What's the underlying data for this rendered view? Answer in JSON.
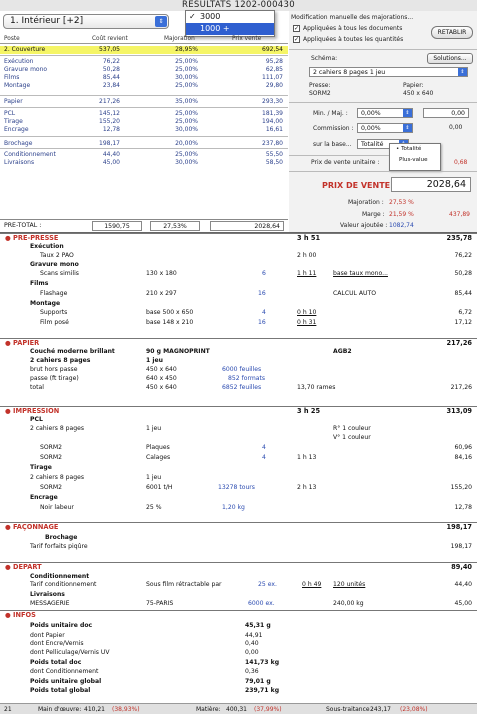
{
  "window": {
    "title": "RESULTATS 1202-000430"
  },
  "selector": {
    "value": "1. Intérieur [+2]"
  },
  "menu": {
    "items": [
      "3000",
      "1000 +"
    ],
    "checked_mark": "✓"
  },
  "left": {
    "headers": {
      "poste": "Poste",
      "cout": "Coût revient",
      "majoration": "Majoration",
      "prix": "Prix vente"
    },
    "rows": [
      {
        "name": "2. Couverture",
        "cout": "537,05",
        "maj": "28,95%",
        "prix": "692,54"
      },
      {
        "name": "Exécution",
        "cout": "76,22",
        "maj": "25,00%",
        "prix": "95,28"
      },
      {
        "name": "Gravure mono",
        "cout": "50,28",
        "maj": "25,00%",
        "prix": "62,85"
      },
      {
        "name": "Films",
        "cout": "85,44",
        "maj": "30,00%",
        "prix": "111,07"
      },
      {
        "name": "Montage",
        "cout": "23,84",
        "maj": "25,00%",
        "prix": "29,80"
      },
      {
        "name": "Papier",
        "cout": "217,26",
        "maj": "35,00%",
        "prix": "293,30"
      },
      {
        "name": "PCL",
        "cout": "145,12",
        "maj": "25,00%",
        "prix": "181,39"
      },
      {
        "name": "Tirage",
        "cout": "155,20",
        "maj": "25,00%",
        "prix": "194,00"
      },
      {
        "name": "Encrage",
        "cout": "12,78",
        "maj": "30,00%",
        "prix": "16,61"
      },
      {
        "name": "Brochage",
        "cout": "198,17",
        "maj": "20,00%",
        "prix": "237,80"
      },
      {
        "name": "Conditionnement",
        "cout": "44,40",
        "maj": "25,00%",
        "prix": "55,50"
      },
      {
        "name": "Livraisons",
        "cout": "45,00",
        "maj": "30,00%",
        "prix": "58,50"
      }
    ],
    "total": {
      "label": "PRE-TOTAL :",
      "cout": "1590,75",
      "maj": "27,53%",
      "prix": "2028,64"
    }
  },
  "right": {
    "modif_title": "Modification manuelle des majorations...",
    "chk1": "Appliquées à tous les documents",
    "chk2": "Appliquées à toutes les quantités",
    "check_mark": "✓",
    "retablir": "RETABLIR",
    "schema_label": "Schéma:",
    "solutions": "Solutions...",
    "schema_value": "2 cahiers 8  pages  1 jeu",
    "presse_label": "Presse:",
    "presse": "SORM2",
    "papier_label": "Papier:",
    "papier": "450 x 640",
    "minmaj_label": "Min. / Maj. :",
    "minmaj": "0,00%",
    "minmaj_val": "0,00",
    "commission_label": "Commission :",
    "commission": "0,00%",
    "commission_val": "0,00",
    "surbase_label": "sur la base...",
    "surbase": "Totalité",
    "opt1": "Totalité",
    "opt2": "Plus-value",
    "pv_unit_label": "Prix de vente unitaire :",
    "pv_unit": "0,68",
    "pv_label": "PRIX DE VENTE :",
    "pv": "2028,64",
    "maj_label": "Majoration :",
    "maj_pct": "27,53 %",
    "marge_label": "Marge :",
    "marge_pct": "21,59 %",
    "marge_val": "437,89",
    "va_label": "Valeur ajoutée :",
    "va_val": "1082,74"
  },
  "sections": {
    "prepresse": {
      "title": "PRE-PRESSE",
      "hours": "3 h 51",
      "value": "235,78"
    },
    "papier": {
      "title": "PAPIER",
      "value": "217,26"
    },
    "impression": {
      "title": "IMPRESSION",
      "hours": "3 h 25",
      "value": "313,09"
    },
    "faconnage": {
      "title": "FAÇONNAGE",
      "value": "198,17"
    },
    "depart": {
      "title": "DEPART",
      "value": "89,40"
    },
    "infos": {
      "title": "INFOS"
    }
  },
  "pp": {
    "l1": "Exécution",
    "l2": "Taux 2 PAO",
    "l2h": "2 h 00",
    "l2v": "76,22",
    "l3": "Gravure mono",
    "l4": "Scans similis",
    "l4a": "130 x 180",
    "l4b": "6",
    "l4c": "1 h 11",
    "l4d": "base taux mono...",
    "l4v": "50,28",
    "l5": "Films",
    "l6": "Flashage",
    "l6a": "210 x 297",
    "l6b": "16",
    "l6c": "CALCUL AUTO",
    "l6v": "85,44",
    "l7": "Montage",
    "l8": "Supports",
    "l8a": "base 500 x 650",
    "l8b": "4",
    "l8c": "0 h 10",
    "l8v": "6,72",
    "l9": "Film posé",
    "l9a": "base 148 x 210",
    "l9b": "16",
    "l9c": "0 h 31",
    "l9v": "17,12"
  },
  "pa": {
    "l1": "Couché moderne brillant",
    "l1b": "90 g MAGNOPRINT",
    "l1c": "AGB2",
    "l2": "2 cahiers 8  pages",
    "l2b": "1 jeu",
    "l3": "brut hors passe",
    "l3a": "450 x 640",
    "l3b": "6000 feuilles",
    "l4": "passe (ft tirage)",
    "l4a": "640 x 450",
    "l4b": "852 formats",
    "l5": "total",
    "l5a": "450 x 640",
    "l5b": "6852 feuilles",
    "l5c": "13,70 rames",
    "l5v": "217,26"
  },
  "im": {
    "l1": "PCL",
    "l2": "2 cahiers 8  pages",
    "l2a": "1 jeu",
    "l2c": "R° 1 couleur",
    "l2d": "V° 1 couleur",
    "l3": "SORM2",
    "l3a": "Plaques",
    "l3b": "4",
    "l3v": "60,96",
    "l4": "SORM2",
    "l4a": "Calages",
    "l4b": "4",
    "l4c": "1 h 13",
    "l4v": "84,16",
    "l5": "Tirage",
    "l6": "2 cahiers 8  pages",
    "l6a": "1 jeu",
    "l7": "SORM2",
    "l7a": "6001 t/H",
    "l7b": "13278  tours",
    "l7c": "2 h 13",
    "l7v": "155,20",
    "l8": "Encrage",
    "l9": "Noir labeur",
    "l9a": "25 %",
    "l9b": "1,20 kg",
    "l9v": "12,78"
  },
  "fa": {
    "l1": "Brochage",
    "l2": "Tarif forfaits piqûre",
    "l2v": "198,17"
  },
  "de": {
    "l1": "Conditionnement",
    "l2": "Tarif conditionnement",
    "l2a": "Sous film rétractable par",
    "l2b": "25 ex.",
    "l2c": "0 h 49",
    "l2d": "120 unités",
    "l2v": "44,40",
    "l3": "Livraisons",
    "l4": "MESSAGERIE",
    "l4a": "75-PARIS",
    "l4b": "6000 ex.",
    "l4c": "240,00 kg",
    "l4v": "45,00"
  },
  "inf": [
    {
      "k": "Poids unitaire doc",
      "v": "45,31  g",
      "b": true
    },
    {
      "k": "dont Papier",
      "v": "44,91",
      "b": false
    },
    {
      "k": "dont Encre/Vernis",
      "v": "0,40",
      "b": false
    },
    {
      "k": "dont Pelliculage/Vernis UV",
      "v": "0,00",
      "b": false
    },
    {
      "k": "Poids total doc",
      "v": "141,73 kg",
      "b": true
    },
    {
      "k": "dont Conditionnement",
      "v": "0,36",
      "b": false
    },
    {
      "k": "Poids unitaire global",
      "v": "79,01  g",
      "b": true
    },
    {
      "k": "Poids total global",
      "v": "239,71 kg",
      "b": true
    }
  ],
  "footer": {
    "page": "21",
    "mo_label": "Main d'œuvre:",
    "mo": "410,21",
    "mo_pct": "(38,93%)",
    "mat_label": "Matière:",
    "mat": "400,31",
    "mat_pct": "(37,99%)",
    "st_label": "Sous-traitance :",
    "st": "243,17",
    "st_pct": "(23,08%)"
  },
  "colors": {
    "accent_red": "#c2322a",
    "highlight": "#f5f566",
    "blue": "#2a4ab0"
  }
}
